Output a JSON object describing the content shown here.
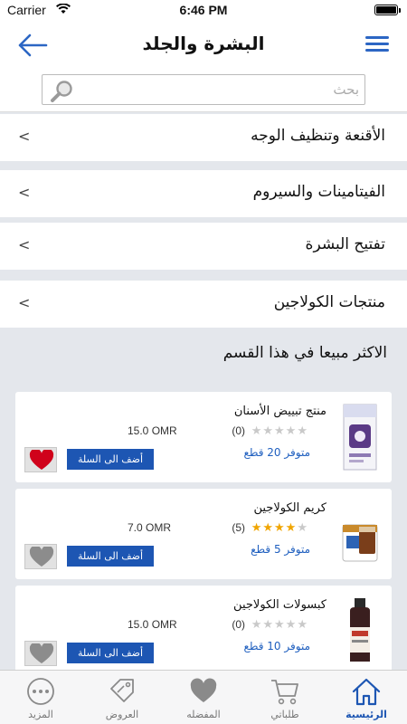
{
  "status": {
    "carrier": "Carrier",
    "time": "6:46 PM"
  },
  "header": {
    "title": "البشرة والجلد"
  },
  "search": {
    "placeholder": "بحث"
  },
  "categories": [
    {
      "label": "الأقنعة وتنظيف الوجه"
    },
    {
      "label": "الفيتامينات والسيروم"
    },
    {
      "label": "تفتيح البشرة"
    },
    {
      "label": "منتجات الكولاجين"
    }
  ],
  "section": {
    "title": "الاكثر مبيعا في هذا القسم"
  },
  "products": [
    {
      "name": "منتج تبييض الأسنان",
      "rating": 0,
      "reviews": "(0)",
      "price": "15.0 OMR",
      "stock": "متوفر 20 قطع",
      "add_label": "أضف الى السلة",
      "favorite": true
    },
    {
      "name": "كريم الكولاجين",
      "rating": 4,
      "reviews": "(5)",
      "price": "7.0 OMR",
      "stock": "متوفر 5 قطع",
      "add_label": "أضف الى السلة",
      "favorite": false
    },
    {
      "name": "كبسولات الكولاجين",
      "rating": 0,
      "reviews": "(0)",
      "price": "15.0 OMR",
      "stock": "متوفر 10 قطع",
      "add_label": "أضف الى السلة",
      "favorite": false
    }
  ],
  "tabs": [
    {
      "label": "المزيد",
      "icon": "more-icon"
    },
    {
      "label": "العروض",
      "icon": "tag-icon"
    },
    {
      "label": "المفضله",
      "icon": "heart-icon"
    },
    {
      "label": "طلباتي",
      "icon": "cart-icon"
    },
    {
      "label": "الرئيسية",
      "icon": "home-icon",
      "active": true
    }
  ],
  "colors": {
    "accent": "#1d56b3",
    "favorite": "#d0021b",
    "star": "#f0a500",
    "background": "#e4e7ec"
  }
}
